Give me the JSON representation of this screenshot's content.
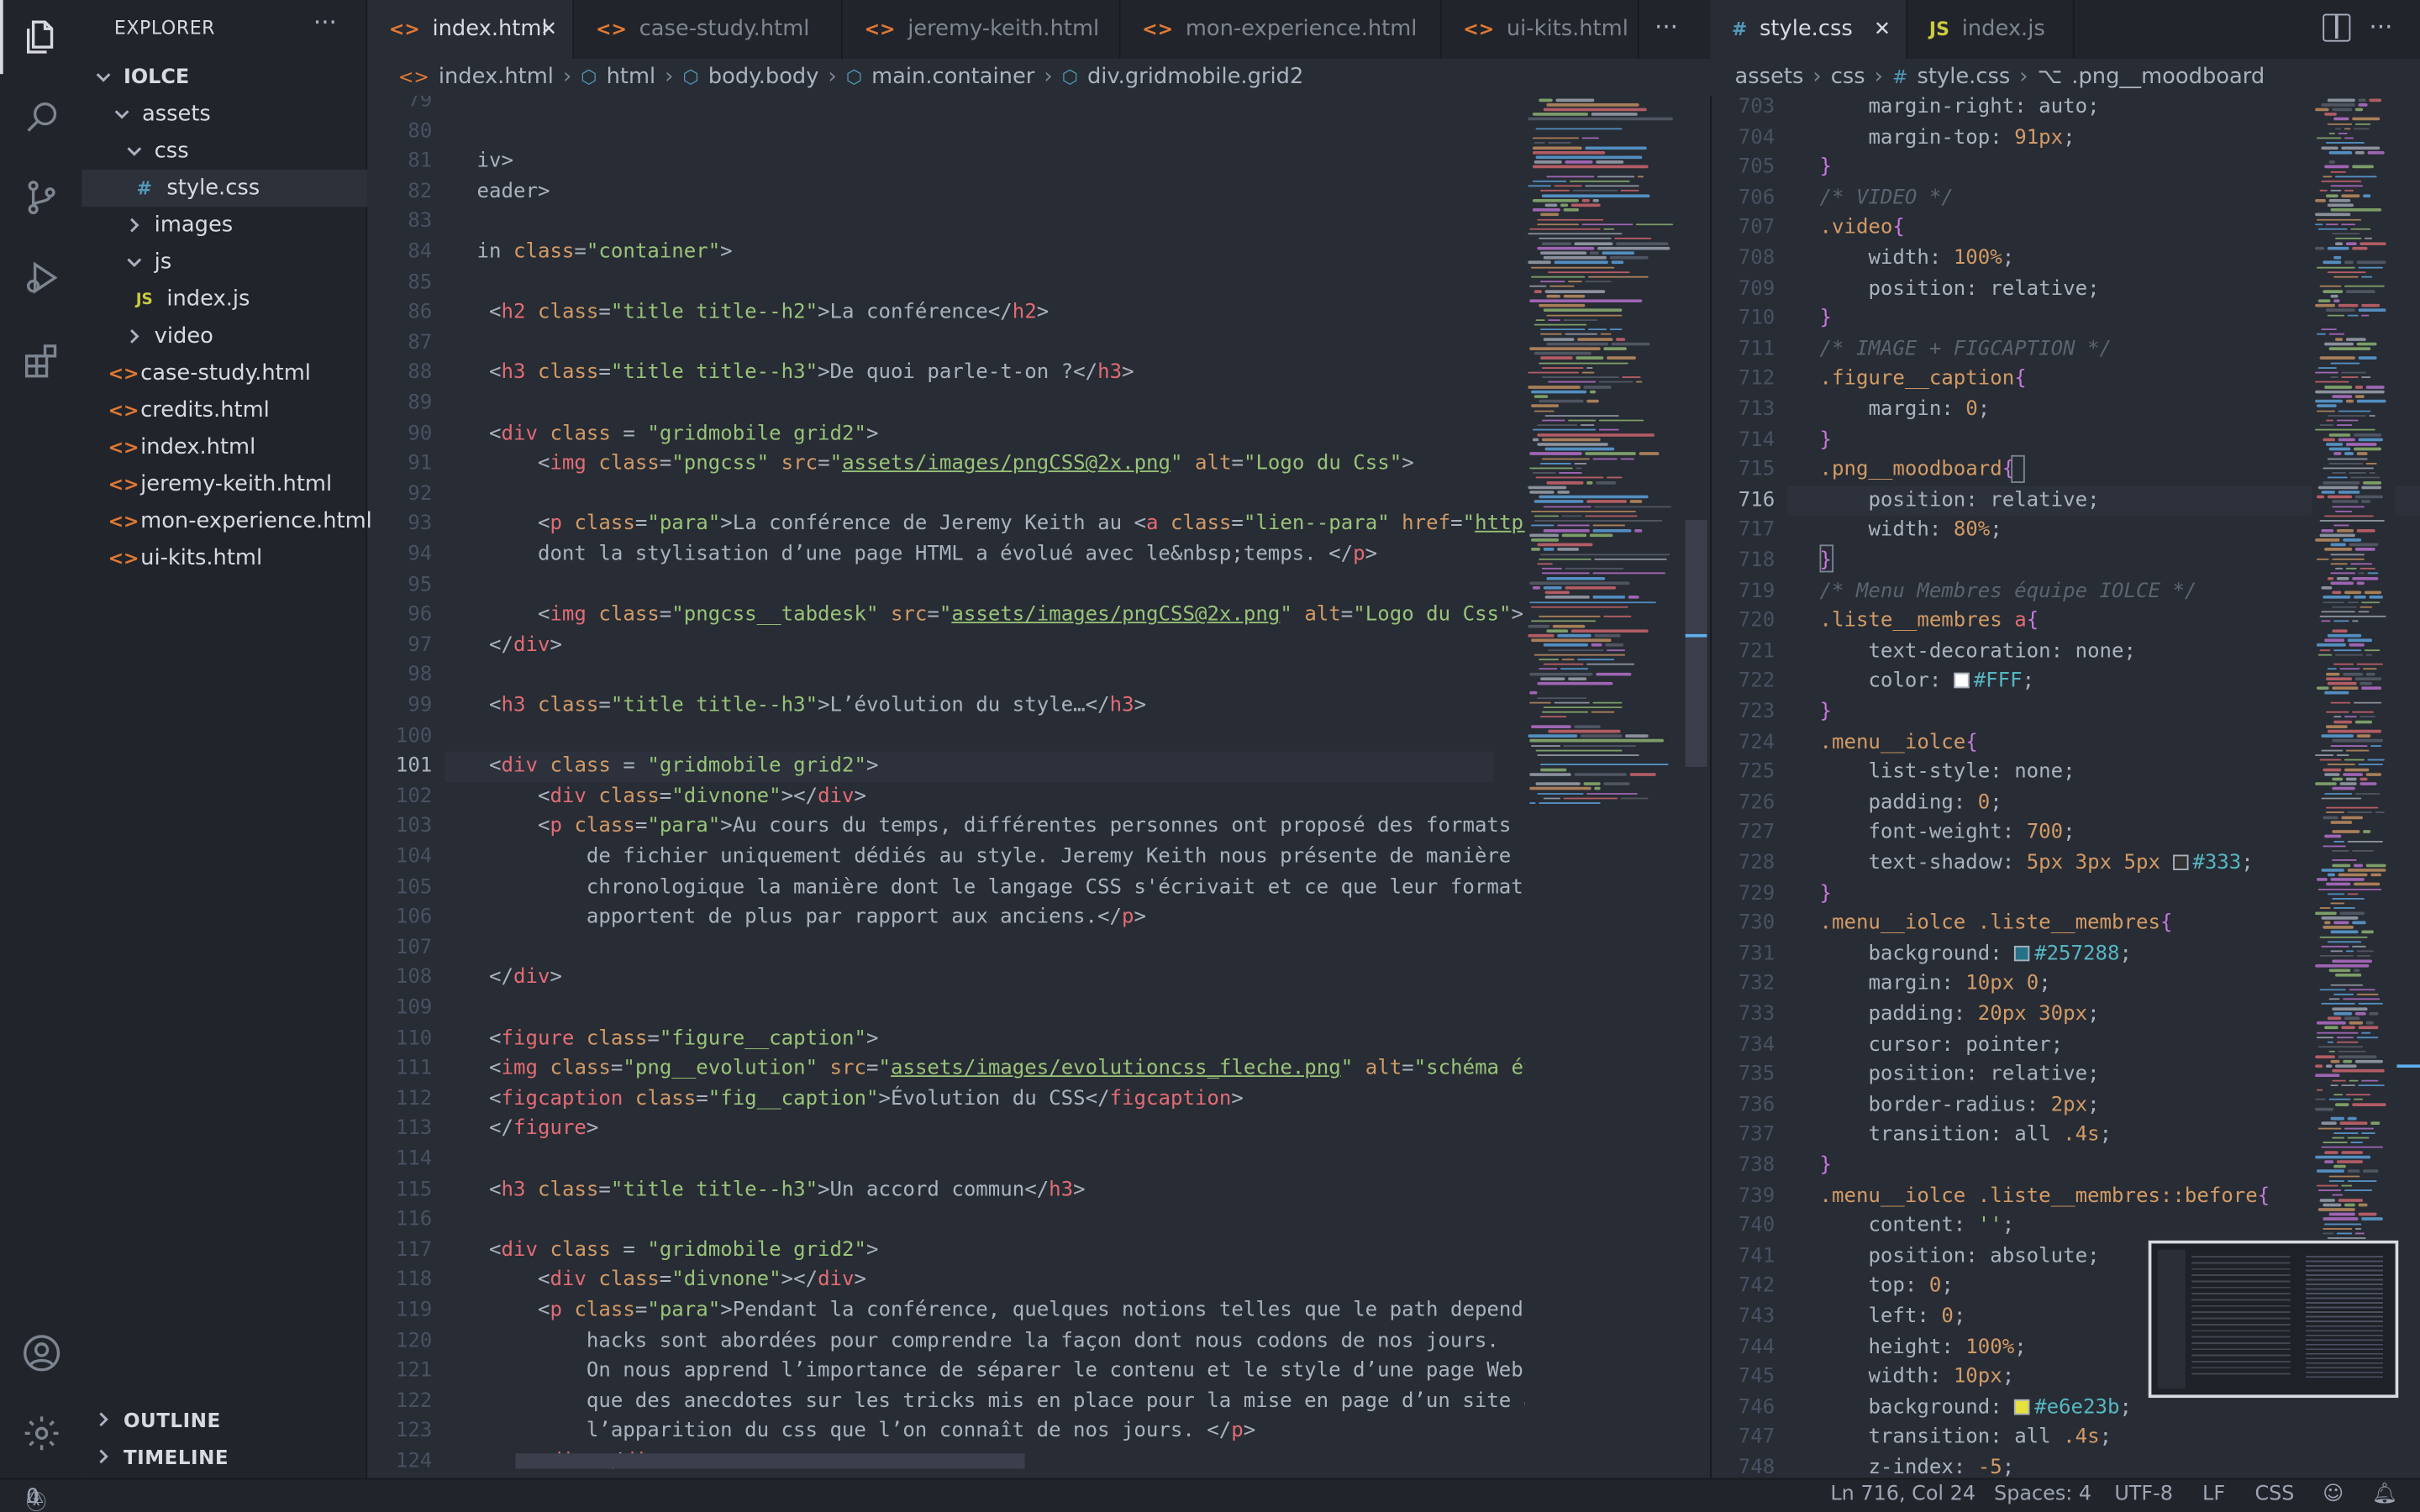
{
  "sidebar": {
    "title": "EXPLORER",
    "more": "···",
    "root": "IOLCE",
    "tree": [
      {
        "label": "assets",
        "type": "folder-open",
        "depth": 1
      },
      {
        "label": "css",
        "type": "folder-open",
        "depth": 2
      },
      {
        "label": "style.css",
        "type": "css",
        "depth": 3,
        "selected": true
      },
      {
        "label": "images",
        "type": "folder",
        "depth": 2
      },
      {
        "label": "js",
        "type": "folder-open",
        "depth": 2
      },
      {
        "label": "index.js",
        "type": "js",
        "depth": 3
      },
      {
        "label": "video",
        "type": "folder",
        "depth": 2
      },
      {
        "label": "case-study.html",
        "type": "html",
        "depth": 1
      },
      {
        "label": "credits.html",
        "type": "html",
        "depth": 1
      },
      {
        "label": "index.html",
        "type": "html",
        "depth": 1
      },
      {
        "label": "jeremy-keith.html",
        "type": "html",
        "depth": 1
      },
      {
        "label": "mon-experience.html",
        "type": "html",
        "depth": 1
      },
      {
        "label": "ui-kits.html",
        "type": "html",
        "depth": 1
      }
    ],
    "outline": "OUTLINE",
    "timeline": "TIMELINE"
  },
  "editor1": {
    "tabs": [
      "index.html",
      "case-study.html",
      "jeremy-keith.html",
      "mon-experience.html",
      "ui-kits.html"
    ],
    "breadcrumb": [
      "index.html",
      "html",
      "body.body",
      "main.container",
      "div.gridmobile.grid2"
    ],
    "current_line": 101,
    "lines": [
      {
        "n": 79,
        "html": ""
      },
      {
        "n": 80,
        "html": ""
      },
      {
        "n": 81,
        "html": "<span class='p'>iv&gt;</span>"
      },
      {
        "n": 82,
        "html": "<span class='p'>eader&gt;</span>"
      },
      {
        "n": 83,
        "html": ""
      },
      {
        "n": 84,
        "html": "<span class='p'>in </span><span class='a'>class</span><span class='p'>=</span><span class='s'>\"container\"</span><span class='p'>&gt;</span>"
      },
      {
        "n": 85,
        "html": ""
      },
      {
        "n": 86,
        "html": " <span class='p'>&lt;</span><span class='t'>h2</span> <span class='a'>class</span><span class='p'>=</span><span class='s'>\"title title--h2\"</span><span class='p'>&gt;La conférence&lt;/</span><span class='t'>h2</span><span class='p'>&gt;</span>"
      },
      {
        "n": 87,
        "html": ""
      },
      {
        "n": 88,
        "html": " <span class='p'>&lt;</span><span class='t'>h3</span> <span class='a'>class</span><span class='p'>=</span><span class='s'>\"title title--h3\"</span><span class='p'>&gt;De quoi parle-t-on ?&lt;/</span><span class='t'>h3</span><span class='p'>&gt;</span>"
      },
      {
        "n": 89,
        "html": ""
      },
      {
        "n": 90,
        "html": " <span class='p'>&lt;</span><span class='t'>div</span> <span class='a'>class</span><span class='p'> = </span><span class='s'>\"gridmobile grid2\"</span><span class='p'>&gt;</span>"
      },
      {
        "n": 91,
        "html": "     <span class='p'>&lt;</span><span class='t'>img</span> <span class='a'>class</span><span class='p'>=</span><span class='s'>\"pngcss\"</span> <span class='a'>src</span><span class='p'>=</span><span class='s'>\"</span><span class='u'>assets/images/pngCSS@2x.png</span><span class='s'>\"</span> <span class='a'>alt</span><span class='p'>=</span><span class='s'>\"Logo du Css\"</span><span class='p'>&gt;</span>"
      },
      {
        "n": 92,
        "html": ""
      },
      {
        "n": 93,
        "html": "     <span class='p'>&lt;</span><span class='t'>p</span> <span class='a'>class</span><span class='p'>=</span><span class='s'>\"para\"</span><span class='p'>&gt;La conférence de Jeremy Keith au &lt;</span><span class='t'>a</span> <span class='a'>class</span><span class='p'>=</span><span class='s'>\"lien--para\"</span> <span class='a'>href</span><span class='p'>=</span><span class='s'>\"</span><span class='u'>https</span>"
      },
      {
        "n": 94,
        "html": "     <span class='p'>dont la stylisation d’une page HTML a évolué avec le&amp;nbsp;temps. &lt;/</span><span class='t'>p</span><span class='p'>&gt;</span>"
      },
      {
        "n": 95,
        "html": ""
      },
      {
        "n": 96,
        "html": "     <span class='p'>&lt;</span><span class='t'>img</span> <span class='a'>class</span><span class='p'>=</span><span class='s'>\"pngcss__tabdesk\"</span> <span class='a'>src</span><span class='p'>=</span><span class='s'>\"</span><span class='u'>assets/images/pngCSS@2x.png</span><span class='s'>\"</span> <span class='a'>alt</span><span class='p'>=</span><span class='s'>\"Logo du Css\"</span><span class='p'>&gt;</span>"
      },
      {
        "n": 97,
        "html": " <span class='p'>&lt;/</span><span class='t'>div</span><span class='p'>&gt;</span>"
      },
      {
        "n": 98,
        "html": ""
      },
      {
        "n": 99,
        "html": " <span class='p'>&lt;</span><span class='t'>h3</span> <span class='a'>class</span><span class='p'>=</span><span class='s'>\"title title--h3\"</span><span class='p'>&gt;L’évolution du style…&lt;/</span><span class='t'>h3</span><span class='p'>&gt;</span>"
      },
      {
        "n": 100,
        "html": ""
      },
      {
        "n": 101,
        "html": " <span class='p'>&lt;</span><span class='t'>div</span> <span class='a'>class</span><span class='p'> = </span><span class='s'>\"gridmobile grid2\"</span><span class='p'>&gt;</span>"
      },
      {
        "n": 102,
        "html": "     <span class='p'>&lt;</span><span class='t'>div</span> <span class='a'>class</span><span class='p'>=</span><span class='s'>\"divnone\"</span><span class='p'>&gt;&lt;/</span><span class='t'>div</span><span class='p'>&gt;</span>"
      },
      {
        "n": 103,
        "html": "     <span class='p'>&lt;</span><span class='t'>p</span> <span class='a'>class</span><span class='p'>=</span><span class='s'>\"para\"</span><span class='p'>&gt;Au cours du temps, différentes personnes ont proposé des formats</span>"
      },
      {
        "n": 104,
        "html": "         <span class='p'>de fichier uniquement dédiés au style. Jeremy Keith nous présente de manière</span>"
      },
      {
        "n": 105,
        "html": "         <span class='p'>chronologique la manière dont le langage CSS s'écrivait et ce que leur formats</span>"
      },
      {
        "n": 106,
        "html": "         <span class='p'>apportent de plus par rapport aux anciens.&lt;/</span><span class='t'>p</span><span class='p'>&gt;</span>"
      },
      {
        "n": 107,
        "html": ""
      },
      {
        "n": 108,
        "html": " <span class='p'>&lt;/</span><span class='t'>div</span><span class='p'>&gt;</span>"
      },
      {
        "n": 109,
        "html": ""
      },
      {
        "n": 110,
        "html": " <span class='p'>&lt;</span><span class='t'>figure</span> <span class='a'>class</span><span class='p'>=</span><span class='s'>\"figure__caption\"</span><span class='p'>&gt;</span>"
      },
      {
        "n": 111,
        "html": " <span class='p'>&lt;</span><span class='t'>img</span> <span class='a'>class</span><span class='p'>=</span><span class='s'>\"png__evolution\"</span> <span class='a'>src</span><span class='p'>=</span><span class='s'>\"</span><span class='u'>assets/images/evolutioncss_fleche.png</span><span class='s'>\"</span> <span class='a'>alt</span><span class='p'>=</span><span class='s'>\"schéma év</span>"
      },
      {
        "n": 112,
        "html": " <span class='p'>&lt;</span><span class='t'>figcaption</span> <span class='a'>class</span><span class='p'>=</span><span class='s'>\"fig__caption\"</span><span class='p'>&gt;Évolution du CSS&lt;/</span><span class='t'>figcaption</span><span class='p'>&gt;</span>"
      },
      {
        "n": 113,
        "html": " <span class='p'>&lt;/</span><span class='t'>figure</span><span class='p'>&gt;</span>"
      },
      {
        "n": 114,
        "html": ""
      },
      {
        "n": 115,
        "html": " <span class='p'>&lt;</span><span class='t'>h3</span> <span class='a'>class</span><span class='p'>=</span><span class='s'>\"title title--h3\"</span><span class='p'>&gt;Un accord commun&lt;/</span><span class='t'>h3</span><span class='p'>&gt;</span>"
      },
      {
        "n": 116,
        "html": ""
      },
      {
        "n": 117,
        "html": " <span class='p'>&lt;</span><span class='t'>div</span> <span class='a'>class</span><span class='p'> = </span><span class='s'>\"gridmobile grid2\"</span><span class='p'>&gt;</span>"
      },
      {
        "n": 118,
        "html": "     <span class='p'>&lt;</span><span class='t'>div</span> <span class='a'>class</span><span class='p'>=</span><span class='s'>\"divnone\"</span><span class='p'>&gt;&lt;/</span><span class='t'>div</span><span class='p'>&gt;</span>"
      },
      {
        "n": 119,
        "html": "     <span class='p'>&lt;</span><span class='t'>p</span> <span class='a'>class</span><span class='p'>=</span><span class='s'>\"para\"</span><span class='p'>&gt;Pendant la conférence, quelques notions telles que le path depend</span>"
      },
      {
        "n": 120,
        "html": "         <span class='p'>hacks sont abordées pour comprendre la façon dont nous codons de nos jours.</span>"
      },
      {
        "n": 121,
        "html": "         <span class='p'>On nous apprend l’importance de séparer le contenu et le style d’une page Web</span>"
      },
      {
        "n": 122,
        "html": "         <span class='p'>que des anecdotes sur les tricks mis en place pour la mise en page d’un site a</span>"
      },
      {
        "n": 123,
        "html": "         <span class='p'>l’apparition du css que l’on connaît de nos jours. &lt;/</span><span class='t'>p</span><span class='p'>&gt;</span>"
      },
      {
        "n": 124,
        "html": "     <span class='p'>&lt;</span><span class='t'>div</span><span class='p'>&gt;&lt;/</span><span class='t'>div</span><span class='p'>&gt;</span>"
      }
    ]
  },
  "editor2": {
    "tabs": [
      "style.css",
      "index.js"
    ],
    "breadcrumb": [
      "assets",
      "css",
      "style.css",
      ".png__moodboard"
    ],
    "current_line": 716,
    "lines": [
      {
        "n": 703,
        "html": "    <span class='p'>margin-right: </span><span class='p'>auto;</span>"
      },
      {
        "n": 704,
        "html": "    <span class='p'>margin-top: </span><span class='n'>91px</span><span class='p'>;</span>"
      },
      {
        "n": 705,
        "html": "<span class='k'>}</span>"
      },
      {
        "n": 706,
        "html": "<span class='c'>/* VIDEO */</span>"
      },
      {
        "n": 707,
        "html": "<span class='cls'>.video</span><span class='k'>{</span>"
      },
      {
        "n": 708,
        "html": "    <span class='p'>width: </span><span class='n'>100%</span><span class='p'>;</span>"
      },
      {
        "n": 709,
        "html": "    <span class='p'>position: relative;</span>"
      },
      {
        "n": 710,
        "html": "<span class='k'>}</span>"
      },
      {
        "n": 711,
        "html": "<span class='c'>/* IMAGE + FIGCAPTION */</span>"
      },
      {
        "n": 712,
        "html": "<span class='cls'>.figure__caption</span><span class='k'>{</span>"
      },
      {
        "n": 713,
        "html": "    <span class='p'>margin: </span><span class='n'>0</span><span class='p'>;</span>"
      },
      {
        "n": 714,
        "html": "<span class='k'>}</span>"
      },
      {
        "n": 715,
        "html": "<span class='cls'>.png__moodboard</span><span class='k'>{</span>"
      },
      {
        "n": 716,
        "html": "    <span class='p'>position: relative;</span>"
      },
      {
        "n": 717,
        "html": "    <span class='p'>width: </span><span class='n'>80%</span><span class='p'>;</span>"
      },
      {
        "n": 718,
        "html": "<span class='k'>}</span>"
      },
      {
        "n": 719,
        "html": "<span class='c'>/* Menu Membres équipe IOLCE */</span>"
      },
      {
        "n": 720,
        "html": "<span class='cls'>.liste__membres</span> <span class='t'>a</span><span class='k'>{</span>"
      },
      {
        "n": 721,
        "html": "    <span class='p'>text-decoration: none;</span>"
      },
      {
        "n": 722,
        "html": "    <span class='p'>color: </span><span class='sw' style='background:#FFF'></span><span class='h'>#FFF</span><span class='p'>;</span>"
      },
      {
        "n": 723,
        "html": "<span class='k'>}</span>"
      },
      {
        "n": 724,
        "html": "<span class='cls'>.menu__iolce</span><span class='k'>{</span>"
      },
      {
        "n": 725,
        "html": "    <span class='p'>list-style: none;</span>"
      },
      {
        "n": 726,
        "html": "    <span class='p'>padding: </span><span class='n'>0</span><span class='p'>;</span>"
      },
      {
        "n": 727,
        "html": "    <span class='p'>font-weight: </span><span class='n'>700</span><span class='p'>;</span>"
      },
      {
        "n": 728,
        "html": "    <span class='p'>text-shadow: </span><span class='n'>5px 3px 5px</span> <span class='sw' style='background:#333'></span><span class='h'>#333</span><span class='p'>;</span>"
      },
      {
        "n": 729,
        "html": "<span class='k'>}</span>"
      },
      {
        "n": 730,
        "html": "<span class='cls'>.menu__iolce .liste__membres</span><span class='k'>{</span>"
      },
      {
        "n": 731,
        "html": "    <span class='p'>background: </span><span class='sw' style='background:#257288'></span><span class='h'>#257288</span><span class='p'>;</span>"
      },
      {
        "n": 732,
        "html": "    <span class='p'>margin: </span><span class='n'>10px 0</span><span class='p'>;</span>"
      },
      {
        "n": 733,
        "html": "    <span class='p'>padding: </span><span class='n'>20px 30px</span><span class='p'>;</span>"
      },
      {
        "n": 734,
        "html": "    <span class='p'>cursor: pointer;</span>"
      },
      {
        "n": 735,
        "html": "    <span class='p'>position: relative;</span>"
      },
      {
        "n": 736,
        "html": "    <span class='p'>border-radius: </span><span class='n'>2px</span><span class='p'>;</span>"
      },
      {
        "n": 737,
        "html": "    <span class='p'>transition: all </span><span class='n'>.4s</span><span class='p'>;</span>"
      },
      {
        "n": 738,
        "html": "<span class='k'>}</span>"
      },
      {
        "n": 739,
        "html": "<span class='cls'>.menu__iolce .liste__membres::before</span><span class='k'>{</span>"
      },
      {
        "n": 740,
        "html": "    <span class='p'>content: </span><span class='s'>''</span><span class='p'>;</span>"
      },
      {
        "n": 741,
        "html": "    <span class='p'>position: absolute;</span>"
      },
      {
        "n": 742,
        "html": "    <span class='p'>top: </span><span class='n'>0</span><span class='p'>;</span>"
      },
      {
        "n": 743,
        "html": "    <span class='p'>left: </span><span class='n'>0</span><span class='p'>;</span>"
      },
      {
        "n": 744,
        "html": "    <span class='p'>height: </span><span class='n'>100%</span><span class='p'>;</span>"
      },
      {
        "n": 745,
        "html": "    <span class='p'>width: </span><span class='n'>10px</span><span class='p'>;</span>"
      },
      {
        "n": 746,
        "html": "    <span class='p'>background: </span><span class='sw' style='background:#e6e23b'></span><span class='h'>#e6e23b</span><span class='p'>;</span>"
      },
      {
        "n": 747,
        "html": "    <span class='p'>transition: all </span><span class='n'>.4s</span><span class='p'>;</span>"
      },
      {
        "n": 748,
        "html": "    <span class='p'>z-index: </span><span class='n'>-5</span><span class='p'>;</span>"
      }
    ]
  },
  "status": {
    "errors": "0",
    "warnings": "0",
    "position": "Ln 716, Col 24",
    "spaces": "Spaces: 4",
    "encoding": "UTF-8",
    "eol": "LF",
    "language": "CSS"
  },
  "colors": {
    "accent": "#61afef",
    "bg": "#282c34",
    "sidebar": "#21252b"
  },
  "icons": [
    "files-icon",
    "search-icon",
    "source-control-icon",
    "run-debug-icon",
    "extensions-icon",
    "account-icon",
    "settings-gear-icon",
    "split-editor-icon",
    "more-actions-icon",
    "close-icon"
  ]
}
